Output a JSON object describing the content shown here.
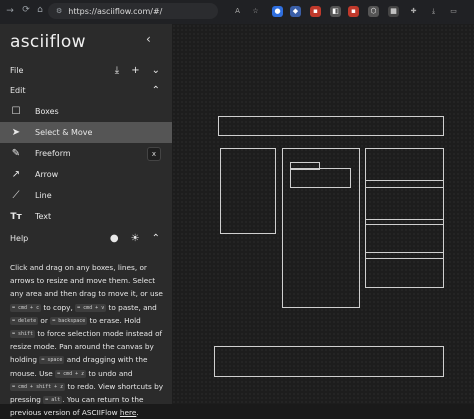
{
  "browser": {
    "url": "https://asciiflow.com/#/"
  },
  "sidebar": {
    "logo": "asciiflow",
    "file_label": "File",
    "edit_label": "Edit",
    "help_label": "Help",
    "tools": [
      {
        "label": "Boxes",
        "icon": "square-icon"
      },
      {
        "label": "Select & Move",
        "icon": "cursor-icon"
      },
      {
        "label": "Freeform",
        "icon": "freeform-icon",
        "shortcut": "x"
      },
      {
        "label": "Arrow",
        "icon": "arrow-icon"
      },
      {
        "label": "Line",
        "icon": "line-icon"
      },
      {
        "label": "Text",
        "icon": "text-icon"
      }
    ]
  },
  "help": {
    "t1": "Click and drag on any boxes, lines, or arrows to resize and move them. Select any area and then drag to move it, or use ",
    "k1": "⌨ cmd + c",
    "t2": " to copy, ",
    "k2": "⌨ cmd + v",
    "t3": " to paste, and ",
    "k3": "⌨ delete",
    "t4": " or ",
    "k4": "⌨ backspace",
    "t5": " to erase. Hold ",
    "k5": "⌨ shift",
    "t6": " to force selection mode instead of resize mode. Pan around the canvas by holding ",
    "k6": "⌨ space",
    "t7": " and dragging with the mouse. Use ",
    "k7": "⌨ cmd + z",
    "t8": " to undo and ",
    "k8": "⌨ cmd + shift + z",
    "t9": " to redo. View shortcuts by pressing ",
    "k9": "⌨ alt",
    "t10": ". You can return to the previous version of ASCIIFlow ",
    "link": "here",
    "t11": "."
  },
  "colors": {
    "sidebar_bg": "#2b2b2b",
    "active_tool_bg": "#555555",
    "canvas_bg": "#1d1d1d",
    "shape_stroke": "#cfcfcf"
  }
}
